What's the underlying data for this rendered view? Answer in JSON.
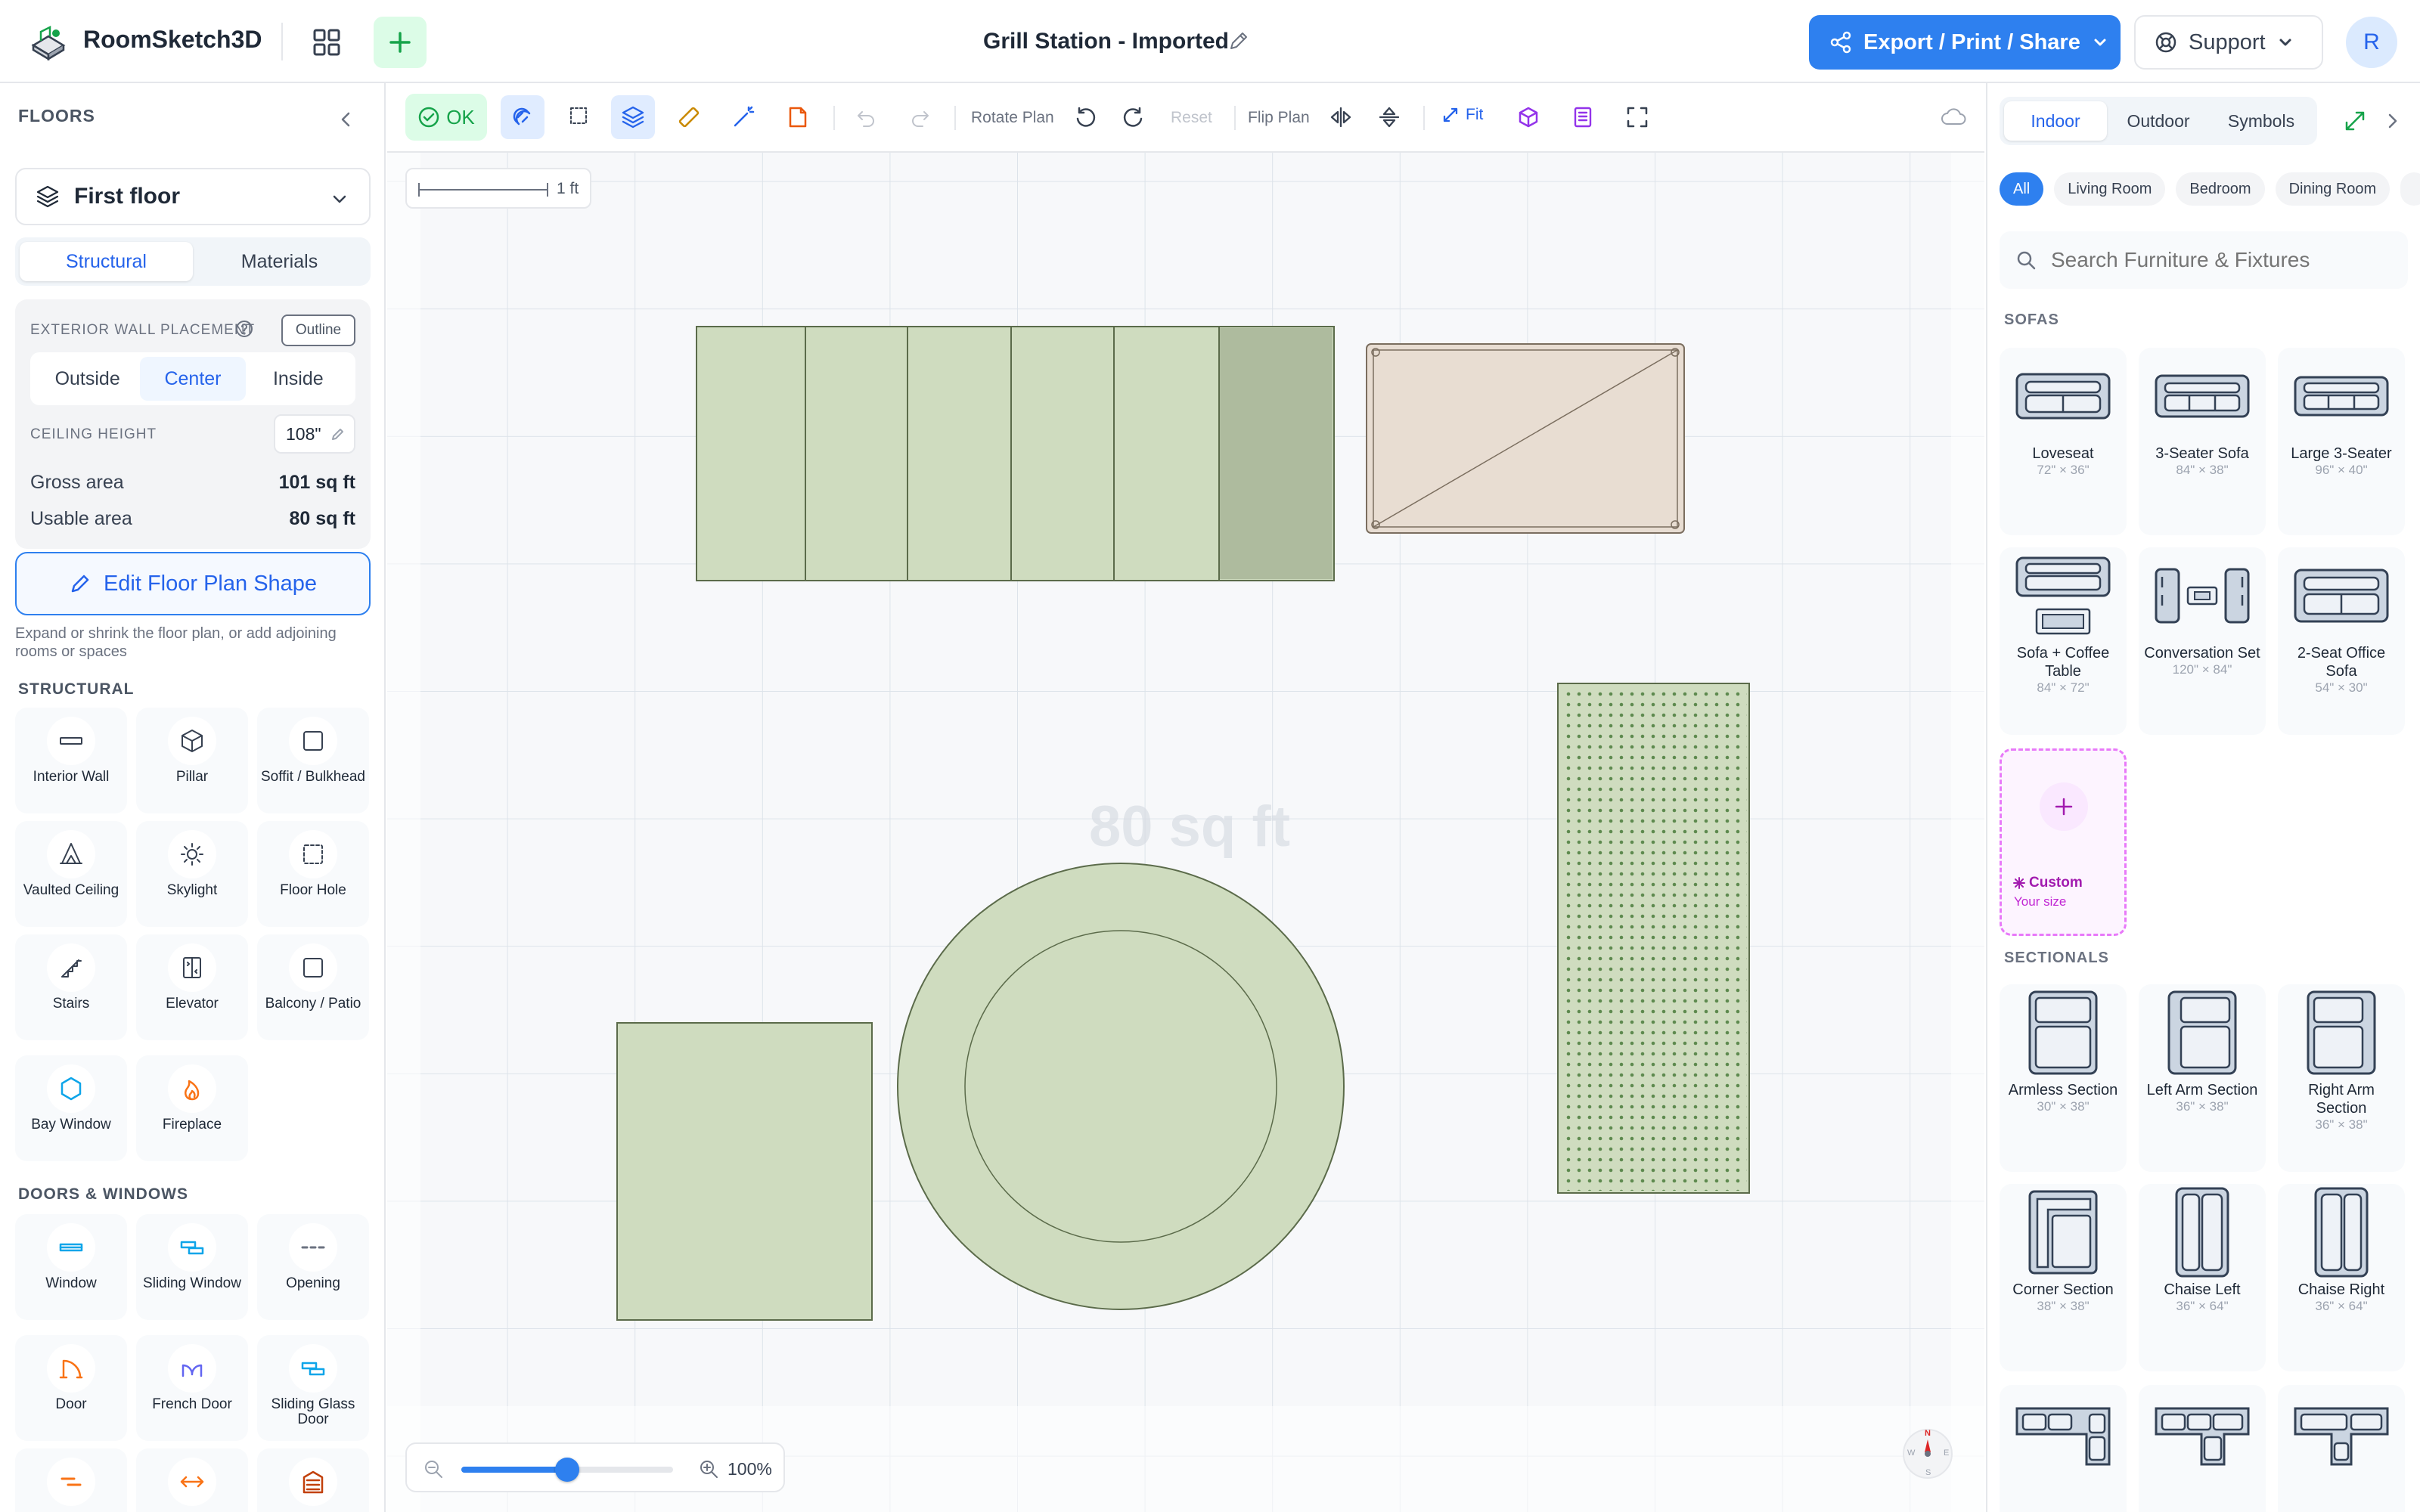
{
  "header": {
    "app_name": "RoomSketch3D",
    "doc_title": "Grill Station - Imported",
    "export_label": "Export / Print / Share",
    "support_label": "Support",
    "avatar_initial": "R"
  },
  "left": {
    "title": "FLOORS",
    "floor": "First floor",
    "tabs": [
      "Structural",
      "Materials"
    ],
    "active_tab": "Structural",
    "wall_placement_label": "EXTERIOR WALL PLACEMENT",
    "outline_label": "Outline",
    "placements": [
      "Outside",
      "Center",
      "Inside"
    ],
    "active_placement": "Center",
    "ceiling_label": "CEILING HEIGHT",
    "ceiling_value": "108\"",
    "gross_label": "Gross area",
    "gross_value": "101 sq ft",
    "usable_label": "Usable area",
    "usable_value": "80 sq ft",
    "edit_label": "Edit Floor Plan Shape",
    "edit_hint": "Expand or shrink the floor plan, or add adjoining rooms or spaces",
    "structural_title": "STRUCTURAL",
    "structural": [
      "Interior Wall",
      "Pillar",
      "Soffit / Bulkhead",
      "Vaulted Ceiling",
      "Skylight",
      "Floor Hole",
      "Stairs",
      "Elevator",
      "Balcony / Patio",
      "Bay Window",
      "Fireplace"
    ],
    "doors_title": "DOORS & WINDOWS",
    "doors": [
      "Window",
      "Sliding Window",
      "Opening",
      "Door",
      "French Door",
      "Sliding Glass Door"
    ]
  },
  "toolbar": {
    "ok_label": "OK",
    "rotate_label": "Rotate Plan",
    "reset_label": "Reset",
    "flip_label": "Flip Plan",
    "fit_label": "Fit"
  },
  "canvas": {
    "scale_label": "1 ft",
    "area_label": "80 sq ft",
    "zoom_label": "100%",
    "zoom_value": 50,
    "compass": {
      "n": "N",
      "w": "W",
      "e": "E",
      "s": "S"
    }
  },
  "right": {
    "tabs": [
      "Indoor",
      "Outdoor",
      "Symbols"
    ],
    "active_tab": "Indoor",
    "chips": [
      "All",
      "Living Room",
      "Bedroom",
      "Dining Room"
    ],
    "active_chip": "All",
    "search_placeholder": "Search Furniture & Fixtures",
    "sofas_title": "SOFAS",
    "sofas": [
      {
        "name": "Loveseat",
        "size": "72\" × 36\""
      },
      {
        "name": "3-Seater Sofa",
        "size": "84\" × 38\""
      },
      {
        "name": "Large 3-Seater",
        "size": "96\" × 40\""
      },
      {
        "name": "Sofa + Coffee Table",
        "size": "84\" × 72\""
      },
      {
        "name": "Conversation Set",
        "size": "120\" × 84\""
      },
      {
        "name": "2-Seat Office Sofa",
        "size": "54\" × 30\""
      }
    ],
    "custom_label": "Custom",
    "custom_sub": "Your size",
    "sectionals_title": "SECTIONALS",
    "sectionals": [
      {
        "name": "Armless Section",
        "size": "30\" × 38\""
      },
      {
        "name": "Left Arm Section",
        "size": "36\" × 38\""
      },
      {
        "name": "Right Arm Section",
        "size": "36\" × 38\""
      },
      {
        "name": "Corner Section",
        "size": "38\" × 38\""
      },
      {
        "name": "Chaise Left",
        "size": "36\" × 64\""
      },
      {
        "name": "Chaise Right",
        "size": "36\" × 64\""
      }
    ]
  },
  "colors": {
    "accent": "#2e80ef",
    "object_fill": "#cfdcbf",
    "object_stroke": "#5b6b4a",
    "table_fill": "#e8ddd2",
    "ok_green": "#16a34a",
    "custom_purple": "#a21caf"
  }
}
